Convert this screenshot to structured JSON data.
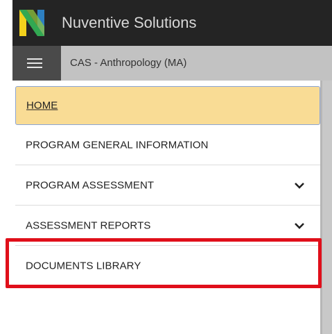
{
  "app": {
    "title": "Nuventive Solutions"
  },
  "header": {
    "program_title": "CAS - Anthropology (MA)"
  },
  "nav": {
    "items": [
      {
        "label": "HOME",
        "active": true
      },
      {
        "label": "PROGRAM GENERAL INFORMATION"
      },
      {
        "label": "PROGRAM ASSESSMENT",
        "expandable": true
      },
      {
        "label": "ASSESSMENT REPORTS",
        "expandable": true
      },
      {
        "label": "DOCUMENTS LIBRARY",
        "highlighted": true
      }
    ]
  },
  "colors": {
    "topbar": "#242424",
    "subbar": "#c2c2c2",
    "menu_button": "#4a4a4a",
    "active_item": "#f9dc95",
    "highlight_border": "#e00f1a",
    "logo_yellow": "#f2d11c",
    "logo_green": "#32a852",
    "logo_blue": "#2d7fc1"
  },
  "icons": {
    "logo": "nuventive-n-logo",
    "menu": "hamburger-icon",
    "expand": "chevron-down-icon"
  }
}
